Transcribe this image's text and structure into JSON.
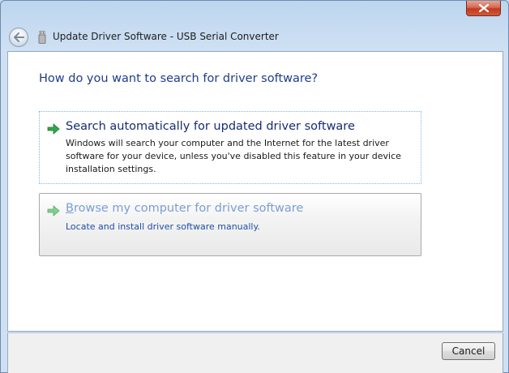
{
  "window": {
    "title": "Update Driver Software - USB Serial Converter",
    "close_label": "Close"
  },
  "page": {
    "heading": "How do you want to search for driver software?"
  },
  "options": [
    {
      "title": "Search automatically for updated driver software",
      "description": "Windows will search your computer and the Internet for the latest driver software for your device, unless you've disabled this feature in your device installation settings.",
      "icon": "green-arrow-icon"
    },
    {
      "title_accesskey": "B",
      "title_rest": "rowse my computer for driver software",
      "description": "Locate and install driver software manually.",
      "icon": "green-arrow-icon"
    }
  ],
  "footer": {
    "cancel_label": "Cancel"
  },
  "colors": {
    "heading": "#1e3c8c",
    "link_blue": "#1f4ea8",
    "arrow_green": "#2ea84a",
    "close_red": "#c2391d"
  }
}
